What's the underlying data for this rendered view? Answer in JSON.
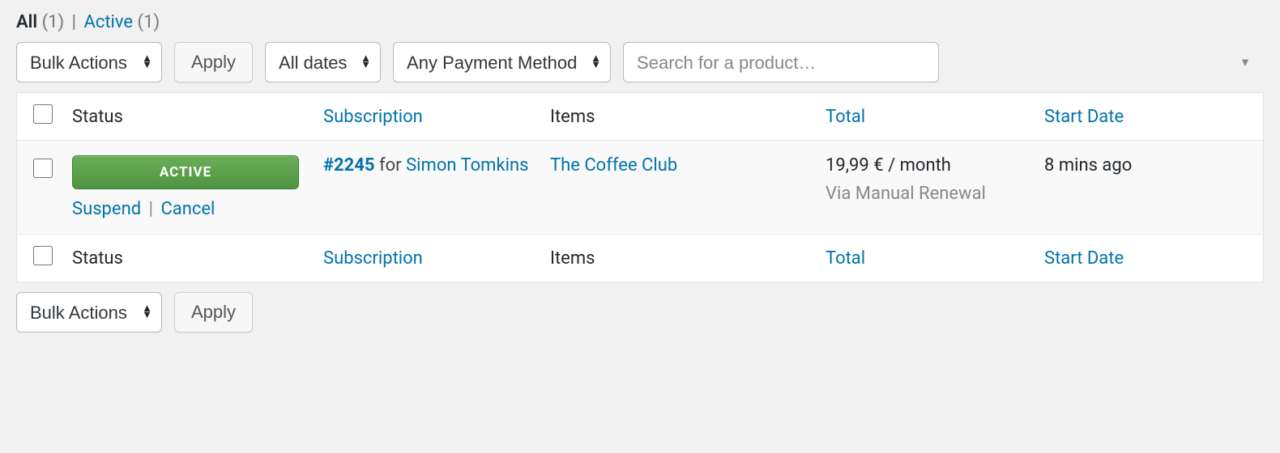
{
  "filters": {
    "all_label": "All",
    "all_count": "(1)",
    "separator": "|",
    "active_label": "Active",
    "active_count": "(1)"
  },
  "bulk": {
    "placeholder": "Bulk Actions",
    "apply": "Apply"
  },
  "date_filter": {
    "selected": "All dates"
  },
  "payment_filter": {
    "selected": "Any Payment Method"
  },
  "product_search": {
    "placeholder": "Search for a product…"
  },
  "columns": {
    "status": "Status",
    "subscription": "Subscription",
    "items": "Items",
    "total": "Total",
    "start_date": "Start Date"
  },
  "row": {
    "status_badge": "ACTIVE",
    "action_suspend": "Suspend",
    "action_cancel": "Cancel",
    "sub_id": "#2245",
    "for_text": " for ",
    "customer": "Simon Tomkins",
    "item": "The Coffee Club",
    "total": "19,99 € / month",
    "renewal": "Via Manual Renewal",
    "start": "8 mins ago"
  }
}
